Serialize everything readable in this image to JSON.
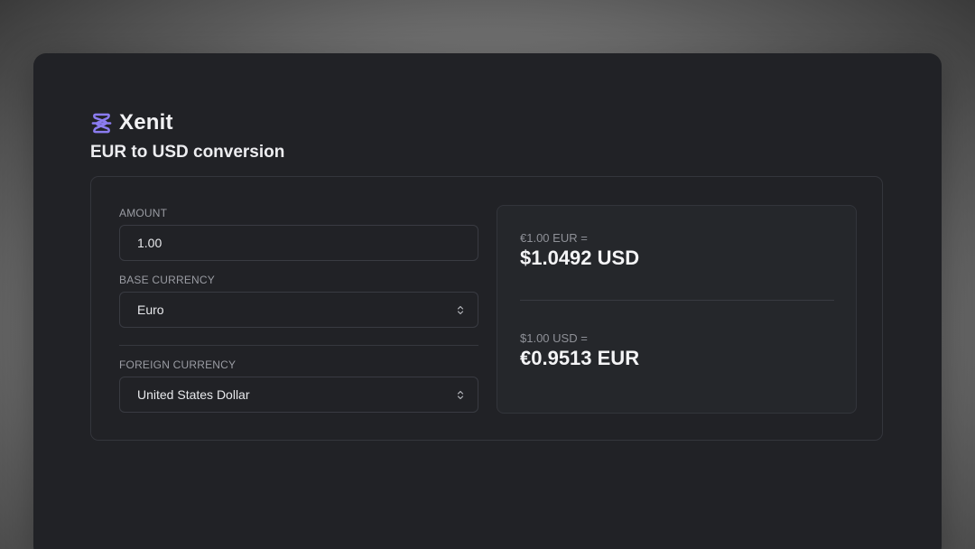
{
  "app": {
    "name": "Xenit",
    "logo_icon": "xenit-logo-icon",
    "accent_color": "#8b7cf0"
  },
  "page": {
    "title": "EUR to USD conversion"
  },
  "form": {
    "amount": {
      "label": "AMOUNT",
      "value": "1.00"
    },
    "base_currency": {
      "label": "BASE CURRENCY",
      "selected": "Euro"
    },
    "foreign_currency": {
      "label": "FOREIGN CURRENCY",
      "selected": "United States Dollar"
    }
  },
  "results": {
    "forward": {
      "caption": "€1.00 EUR =",
      "value": "$1.0492 USD"
    },
    "reverse": {
      "caption": "$1.00 USD =",
      "value": "€0.9513 EUR"
    }
  }
}
